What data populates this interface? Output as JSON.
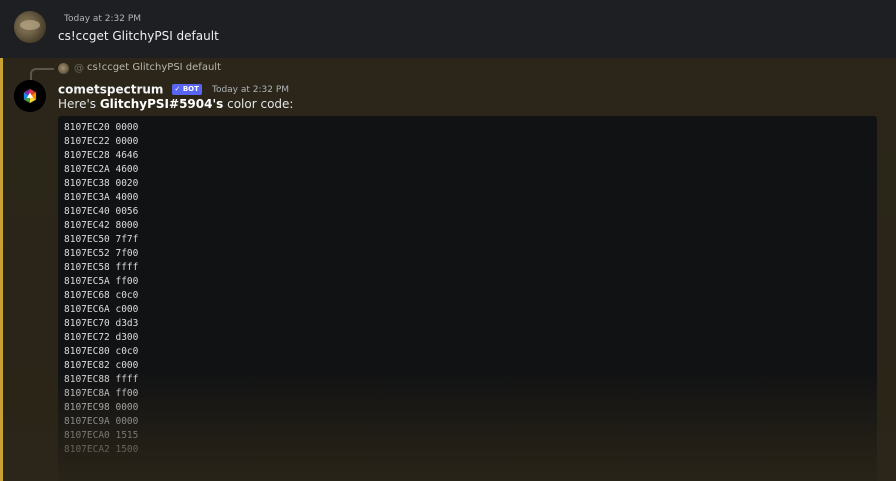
{
  "first_message": {
    "timestamp": "Today at 2:32 PM",
    "text": "cs!ccget GlitchyPSI default"
  },
  "bot_message": {
    "reply_preview": {
      "at_symbol": "@",
      "text": "cs!ccget GlitchyPSI default"
    },
    "author": "cometspectrum",
    "bot_badge": "✓ BOT",
    "timestamp": "Today at 2:32 PM",
    "intro_prefix": "Here's ",
    "intro_bold": "GlitchyPSI#5904's",
    "intro_suffix": " color code:",
    "code_lines": [
      "8107EC20 0000",
      "8107EC22 0000",
      "8107EC28 4646",
      "8107EC2A 4600",
      "8107EC38 0020",
      "8107EC3A 4000",
      "8107EC40 0056",
      "8107EC42 8000",
      "8107EC50 7f7f",
      "8107EC52 7f00",
      "8107EC58 ffff",
      "8107EC5A ff00",
      "8107EC68 c0c0",
      "8107EC6A c000",
      "8107EC70 d3d3",
      "8107EC72 d300",
      "8107EC80 c0c0",
      "8107EC82 c000",
      "8107EC88 ffff",
      "8107EC8A ff00",
      "8107EC98 0000",
      "8107EC9A 0000",
      "8107ECA0 1515",
      "8107ECA2 1500"
    ]
  },
  "colors": {
    "mention_bar": "#c9a234",
    "mention_bg": "#2b2619",
    "bot_badge": "#5865f2",
    "code_bg": "#111214"
  },
  "icons": {
    "user_avatar": "user-avatar-icon",
    "bot_avatar": "cometspectrum-logo-icon",
    "bot_check": "checkmark-icon"
  }
}
